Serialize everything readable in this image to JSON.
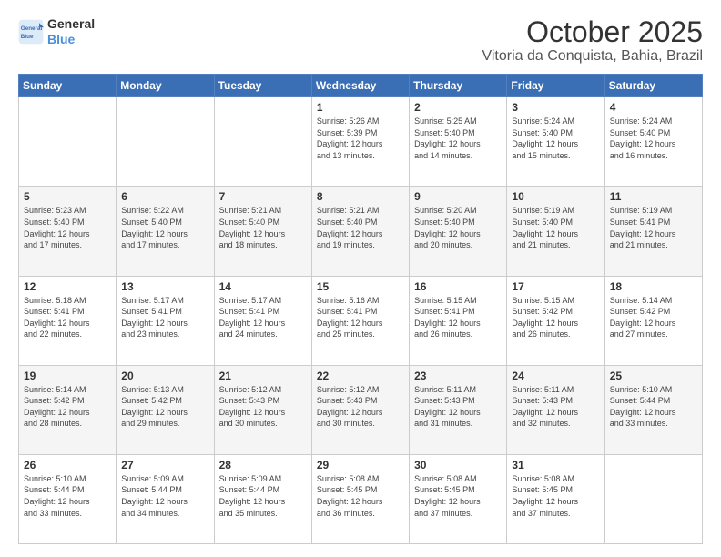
{
  "logo": {
    "line1": "General",
    "line2": "Blue"
  },
  "header": {
    "month": "October 2025",
    "location": "Vitoria da Conquista, Bahia, Brazil"
  },
  "weekdays": [
    "Sunday",
    "Monday",
    "Tuesday",
    "Wednesday",
    "Thursday",
    "Friday",
    "Saturday"
  ],
  "weeks": [
    [
      {
        "day": "",
        "info": ""
      },
      {
        "day": "",
        "info": ""
      },
      {
        "day": "",
        "info": ""
      },
      {
        "day": "1",
        "info": "Sunrise: 5:26 AM\nSunset: 5:39 PM\nDaylight: 12 hours\nand 13 minutes."
      },
      {
        "day": "2",
        "info": "Sunrise: 5:25 AM\nSunset: 5:40 PM\nDaylight: 12 hours\nand 14 minutes."
      },
      {
        "day": "3",
        "info": "Sunrise: 5:24 AM\nSunset: 5:40 PM\nDaylight: 12 hours\nand 15 minutes."
      },
      {
        "day": "4",
        "info": "Sunrise: 5:24 AM\nSunset: 5:40 PM\nDaylight: 12 hours\nand 16 minutes."
      }
    ],
    [
      {
        "day": "5",
        "info": "Sunrise: 5:23 AM\nSunset: 5:40 PM\nDaylight: 12 hours\nand 17 minutes."
      },
      {
        "day": "6",
        "info": "Sunrise: 5:22 AM\nSunset: 5:40 PM\nDaylight: 12 hours\nand 17 minutes."
      },
      {
        "day": "7",
        "info": "Sunrise: 5:21 AM\nSunset: 5:40 PM\nDaylight: 12 hours\nand 18 minutes."
      },
      {
        "day": "8",
        "info": "Sunrise: 5:21 AM\nSunset: 5:40 PM\nDaylight: 12 hours\nand 19 minutes."
      },
      {
        "day": "9",
        "info": "Sunrise: 5:20 AM\nSunset: 5:40 PM\nDaylight: 12 hours\nand 20 minutes."
      },
      {
        "day": "10",
        "info": "Sunrise: 5:19 AM\nSunset: 5:40 PM\nDaylight: 12 hours\nand 21 minutes."
      },
      {
        "day": "11",
        "info": "Sunrise: 5:19 AM\nSunset: 5:41 PM\nDaylight: 12 hours\nand 21 minutes."
      }
    ],
    [
      {
        "day": "12",
        "info": "Sunrise: 5:18 AM\nSunset: 5:41 PM\nDaylight: 12 hours\nand 22 minutes."
      },
      {
        "day": "13",
        "info": "Sunrise: 5:17 AM\nSunset: 5:41 PM\nDaylight: 12 hours\nand 23 minutes."
      },
      {
        "day": "14",
        "info": "Sunrise: 5:17 AM\nSunset: 5:41 PM\nDaylight: 12 hours\nand 24 minutes."
      },
      {
        "day": "15",
        "info": "Sunrise: 5:16 AM\nSunset: 5:41 PM\nDaylight: 12 hours\nand 25 minutes."
      },
      {
        "day": "16",
        "info": "Sunrise: 5:15 AM\nSunset: 5:41 PM\nDaylight: 12 hours\nand 26 minutes."
      },
      {
        "day": "17",
        "info": "Sunrise: 5:15 AM\nSunset: 5:42 PM\nDaylight: 12 hours\nand 26 minutes."
      },
      {
        "day": "18",
        "info": "Sunrise: 5:14 AM\nSunset: 5:42 PM\nDaylight: 12 hours\nand 27 minutes."
      }
    ],
    [
      {
        "day": "19",
        "info": "Sunrise: 5:14 AM\nSunset: 5:42 PM\nDaylight: 12 hours\nand 28 minutes."
      },
      {
        "day": "20",
        "info": "Sunrise: 5:13 AM\nSunset: 5:42 PM\nDaylight: 12 hours\nand 29 minutes."
      },
      {
        "day": "21",
        "info": "Sunrise: 5:12 AM\nSunset: 5:43 PM\nDaylight: 12 hours\nand 30 minutes."
      },
      {
        "day": "22",
        "info": "Sunrise: 5:12 AM\nSunset: 5:43 PM\nDaylight: 12 hours\nand 30 minutes."
      },
      {
        "day": "23",
        "info": "Sunrise: 5:11 AM\nSunset: 5:43 PM\nDaylight: 12 hours\nand 31 minutes."
      },
      {
        "day": "24",
        "info": "Sunrise: 5:11 AM\nSunset: 5:43 PM\nDaylight: 12 hours\nand 32 minutes."
      },
      {
        "day": "25",
        "info": "Sunrise: 5:10 AM\nSunset: 5:44 PM\nDaylight: 12 hours\nand 33 minutes."
      }
    ],
    [
      {
        "day": "26",
        "info": "Sunrise: 5:10 AM\nSunset: 5:44 PM\nDaylight: 12 hours\nand 33 minutes."
      },
      {
        "day": "27",
        "info": "Sunrise: 5:09 AM\nSunset: 5:44 PM\nDaylight: 12 hours\nand 34 minutes."
      },
      {
        "day": "28",
        "info": "Sunrise: 5:09 AM\nSunset: 5:44 PM\nDaylight: 12 hours\nand 35 minutes."
      },
      {
        "day": "29",
        "info": "Sunrise: 5:08 AM\nSunset: 5:45 PM\nDaylight: 12 hours\nand 36 minutes."
      },
      {
        "day": "30",
        "info": "Sunrise: 5:08 AM\nSunset: 5:45 PM\nDaylight: 12 hours\nand 37 minutes."
      },
      {
        "day": "31",
        "info": "Sunrise: 5:08 AM\nSunset: 5:45 PM\nDaylight: 12 hours\nand 37 minutes."
      },
      {
        "day": "",
        "info": ""
      }
    ]
  ]
}
